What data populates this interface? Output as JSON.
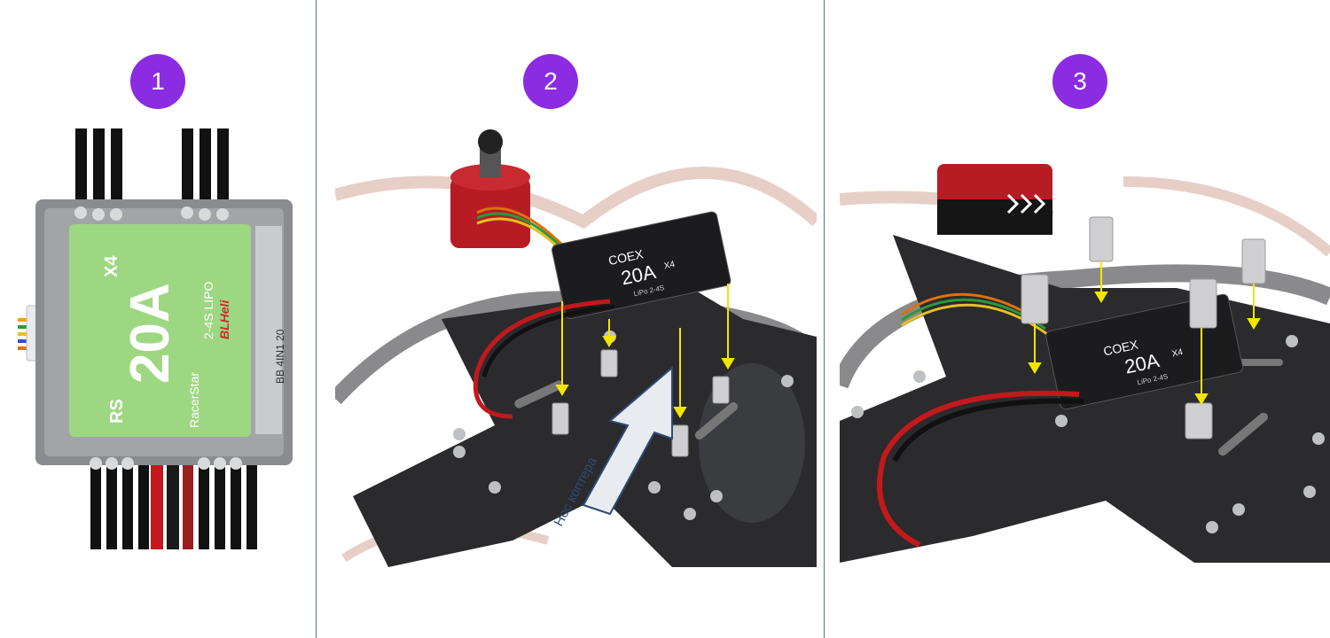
{
  "steps": [
    {
      "number": "1"
    },
    {
      "number": "2"
    },
    {
      "number": "3"
    }
  ],
  "esc_board": {
    "rating": "20A",
    "series": "RS",
    "brand": "RacerStar",
    "count": "X4",
    "lipo": "2-4S LIPO",
    "firmware": "BLHeli",
    "side_label": "BB 4IN1 20"
  },
  "fc_board": {
    "brand": "COEX",
    "rating": "20A",
    "count": "X4",
    "bec": "LiPo 2-4S"
  },
  "annotation": {
    "nose_label": "Нос коптера"
  },
  "colors": {
    "badge": "#8b2be2",
    "divider": "#5b6f8c",
    "pcb_green": "#9ed782",
    "carbon": "#2b2b2d",
    "motor_red": "#b71c25",
    "arrow": "#f2e600"
  }
}
